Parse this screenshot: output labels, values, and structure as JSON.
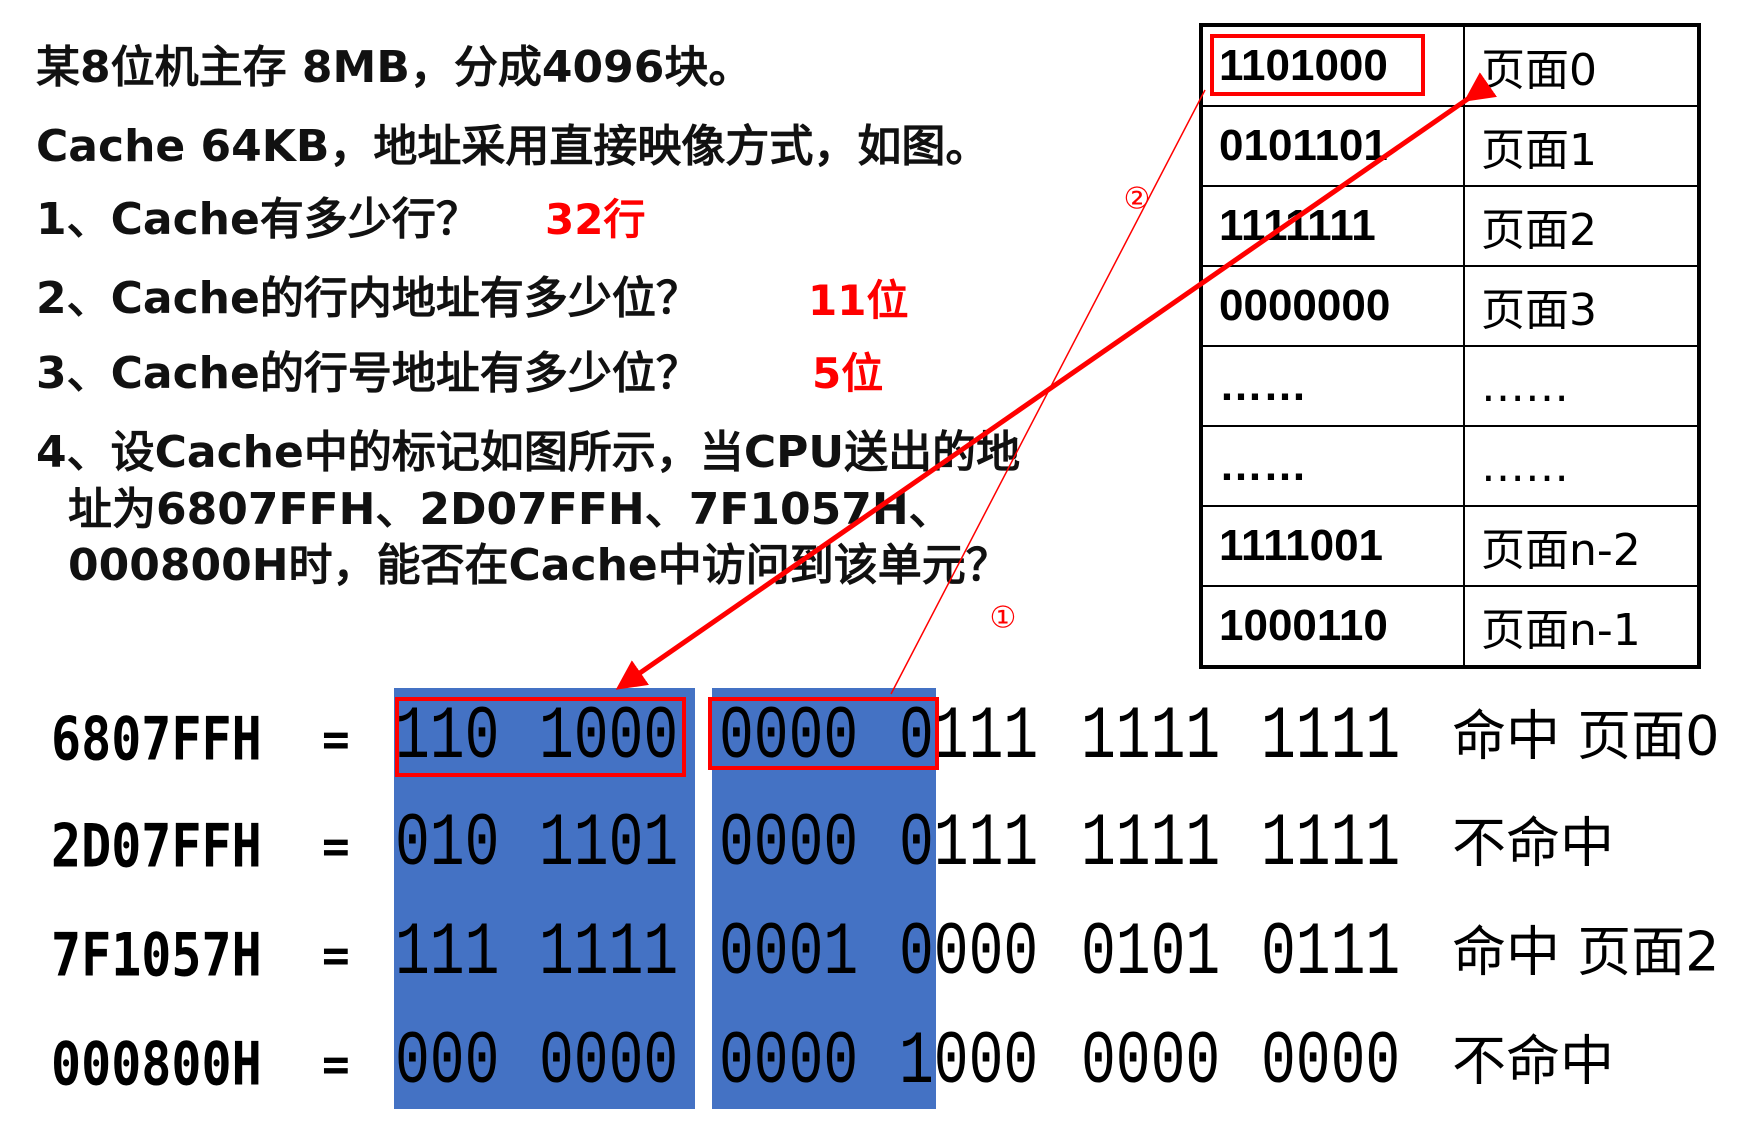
{
  "question": {
    "lines": [
      "某8位机主存 8MB，分成4096块。",
      "Cache 64KB，地址采用直接映像方式，如图。",
      "1、Cache有多少行？",
      "2、Cache的行内地址有多少位？",
      "3、Cache的行号地址有多少位？",
      "4、设Cache中的标记如图所示，当CPU送出的地",
      "址为6807FFH、2D07FFH、7F1057H、",
      "000800H时，能否在Cache中访问到该单元？"
    ],
    "answers": [
      "32行",
      "11位",
      "5位"
    ]
  },
  "tag_table": {
    "rows": [
      {
        "tag": "1101000",
        "page": "页面0"
      },
      {
        "tag": "0101101",
        "page": "页面1"
      },
      {
        "tag": "1111111",
        "page": "页面2"
      },
      {
        "tag": "0000000",
        "page": "页面3"
      },
      {
        "tag": "……",
        "page": "……"
      },
      {
        "tag": "……",
        "page": "……"
      },
      {
        "tag": "1111001",
        "page": "页面n-2"
      },
      {
        "tag": "1000110",
        "page": "页面n-1"
      }
    ]
  },
  "annotations": {
    "circle_1": "①",
    "circle_2": "②"
  },
  "addresses": [
    {
      "hex": "6807FFH",
      "eq": "=",
      "bits": [
        "110",
        "1000",
        "0000",
        "0111",
        "1111",
        "1111"
      ],
      "result": "命中 页面0"
    },
    {
      "hex": "2D07FFH",
      "eq": "=",
      "bits": [
        "010",
        "1101",
        "0000",
        "0111",
        "1111",
        "1111"
      ],
      "result": "不命中"
    },
    {
      "hex": "7F1057H",
      "eq": "=",
      "bits": [
        "111",
        "1111",
        "0001",
        "0000",
        "0101",
        "0111"
      ],
      "result": "命中 页面2"
    },
    {
      "hex": "000800H",
      "eq": "=",
      "bits": [
        "000",
        "0000",
        "0000",
        "1000",
        "0000",
        "0000"
      ],
      "result": "不命中"
    }
  ],
  "colors": {
    "highlight": "#4472c4",
    "accent": "#ff0000"
  }
}
